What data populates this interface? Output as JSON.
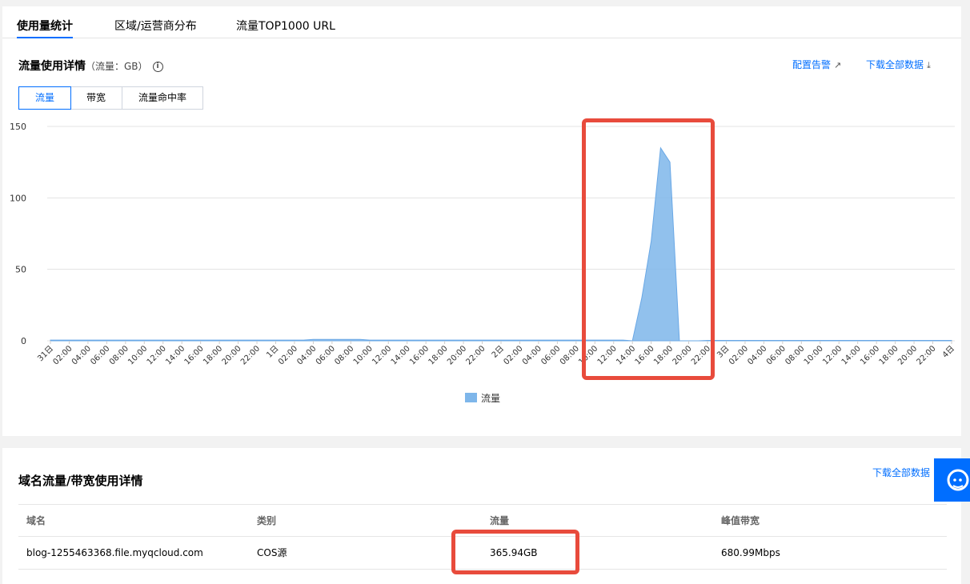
{
  "tabs": [
    {
      "label": "使用量统计"
    },
    {
      "label": "区域/运营商分布"
    },
    {
      "label": "流量TOP1000 URL"
    }
  ],
  "detail": {
    "title": "流量使用详情",
    "subtitle": "（流量：GB）",
    "info_icon": "i",
    "alarm_link": "配置告警",
    "download_link": "下载全部数据"
  },
  "segments": [
    "流量",
    "带宽",
    "流量命中率"
  ],
  "chart_data": {
    "type": "area",
    "ylim": [
      0,
      150
    ],
    "yticks": [
      "0",
      "50",
      "100",
      "150"
    ],
    "x": [
      "31日",
      "02:00",
      "04:00",
      "06:00",
      "08:00",
      "10:00",
      "12:00",
      "14:00",
      "16:00",
      "18:00",
      "20:00",
      "22:00",
      "1日",
      "02:00",
      "04:00",
      "06:00",
      "08:00",
      "10:00",
      "12:00",
      "14:00",
      "16:00",
      "18:00",
      "20:00",
      "22:00",
      "2日",
      "02:00",
      "04:00",
      "06:00",
      "08:00",
      "10:00",
      "12:00",
      "14:00",
      "16:00",
      "18:00",
      "20:00",
      "22:00",
      "3日",
      "02:00",
      "04:00",
      "06:00",
      "08:00",
      "10:00",
      "12:00",
      "14:00",
      "16:00",
      "18:00",
      "20:00",
      "22:00",
      "4日"
    ],
    "series": [
      {
        "name": "流量",
        "color": "#7eb6ea",
        "values": [
          0.5,
          0.5,
          0.5,
          0.5,
          0.5,
          0.5,
          0.5,
          0.5,
          0.5,
          0.5,
          0.5,
          0.5,
          0.5,
          0.5,
          0.5,
          0.5,
          0.5,
          0.5,
          0.5,
          0.5,
          0.5,
          0.5,
          0.5,
          0.5,
          1,
          0.5,
          0.5,
          0.5,
          0.5,
          0.5,
          1,
          0.5,
          0.5,
          0.5,
          0,
          30,
          70,
          135,
          125,
          0,
          0,
          0,
          0,
          0,
          0,
          0,
          0,
          0,
          0,
          0,
          0,
          0,
          0,
          0,
          0,
          0,
          0,
          0,
          0,
          0,
          0,
          0,
          0,
          0,
          0,
          0,
          0,
          0,
          0,
          0,
          0,
          0,
          0,
          0,
          0,
          0,
          0,
          0,
          0,
          0,
          0,
          0,
          0,
          0,
          0,
          0,
          0,
          0,
          0,
          0,
          0,
          0,
          0,
          0,
          0,
          0,
          0
        ],
        "step_hours": 1
      }
    ],
    "legend": "流量",
    "legend_position": "bottom-center",
    "grid": true
  },
  "domain_section": {
    "title": "域名流量/带宽使用详情",
    "download_link": "下载全部数据",
    "columns": [
      "域名",
      "类别",
      "流量",
      "峰值带宽"
    ],
    "rows": [
      [
        "blog-1255463368.file.myqcloud.com",
        "COS源",
        "365.94GB",
        "680.99Mbps"
      ]
    ]
  },
  "support_icon": "customer-service-icon"
}
